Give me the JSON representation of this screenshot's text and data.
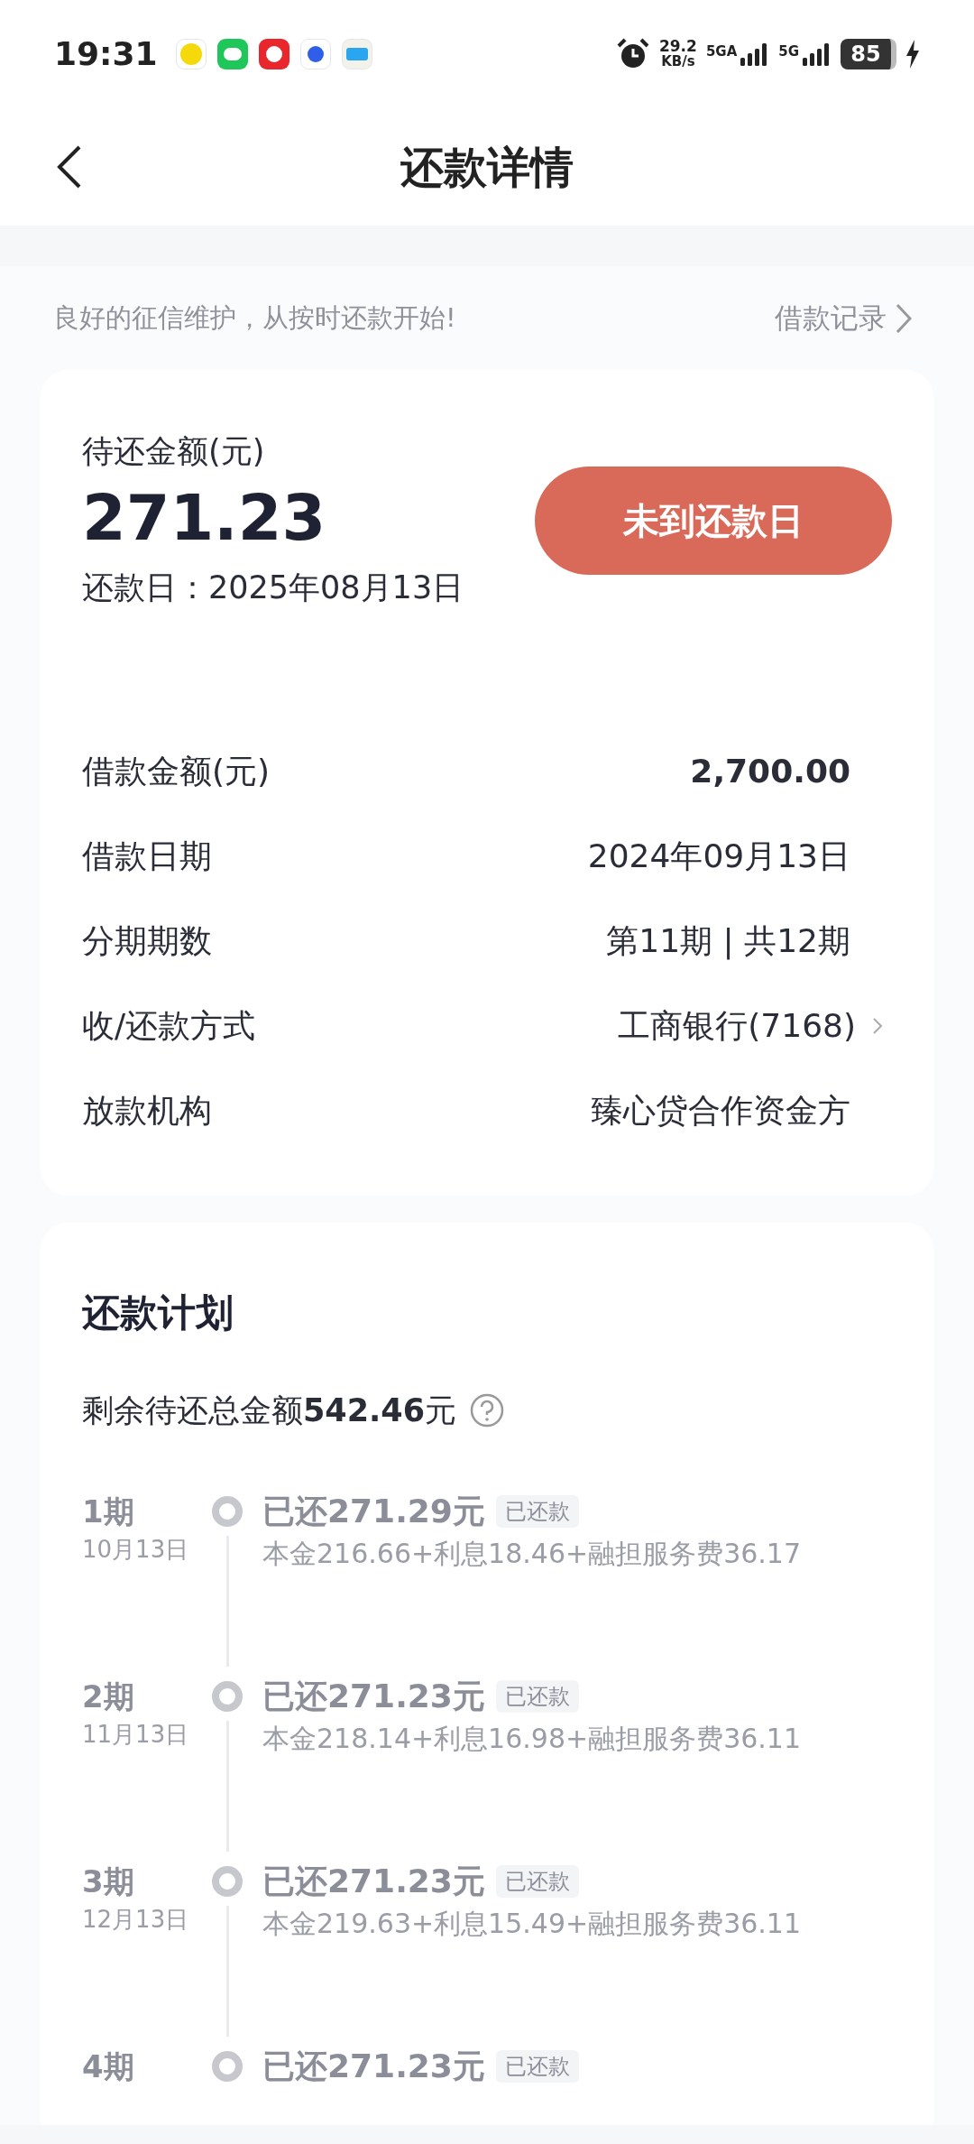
{
  "status_bar": {
    "time": "19:31",
    "speed_value": "29.2",
    "speed_unit": "KB/s",
    "sim1": "5GA",
    "sim2": "5G",
    "battery": "85"
  },
  "header": {
    "title": "还款详情"
  },
  "tip": {
    "text": "良好的征信维护，从按时还款开始!",
    "link": "借款记录"
  },
  "summary": {
    "label": "待还金额(元)",
    "amount": "271.23",
    "due_date": "还款日：2025年08月13日",
    "button": "未到还款日",
    "button_disabled": true
  },
  "details": [
    {
      "label": "借款金额(元)",
      "value": "2,700.00",
      "kind": "amount"
    },
    {
      "label": "借款日期",
      "value": "2024年09月13日",
      "kind": "plain"
    },
    {
      "label": "分期期数",
      "value": "第11期 | 共12期",
      "kind": "plain"
    },
    {
      "label": "收/还款方式",
      "value": "工商银行(7168)",
      "kind": "link"
    },
    {
      "label": "放款机构",
      "value": "臻心贷合作资金方",
      "kind": "plain"
    }
  ],
  "plan": {
    "title": "还款计划",
    "remaining": "剩余待还总金额**542.46**元",
    "installments": [
      {
        "period": "1期",
        "date": "10月13日",
        "amount": "已还271.29元",
        "status": "已还款",
        "breakdown": "本金216.66+利息18.46+融担服务费36.17",
        "paid": true
      },
      {
        "period": "2期",
        "date": "11月13日",
        "amount": "已还271.23元",
        "status": "已还款",
        "breakdown": "本金218.14+利息16.98+融担服务费36.11",
        "paid": true
      },
      {
        "period": "3期",
        "date": "12月13日",
        "amount": "已还271.23元",
        "status": "已还款",
        "breakdown": "本金219.63+利息15.49+融担服务费36.11",
        "paid": true
      },
      {
        "period": "4期",
        "amount": "已还271.23元",
        "status": "已还款",
        "paid": true
      }
    ]
  }
}
